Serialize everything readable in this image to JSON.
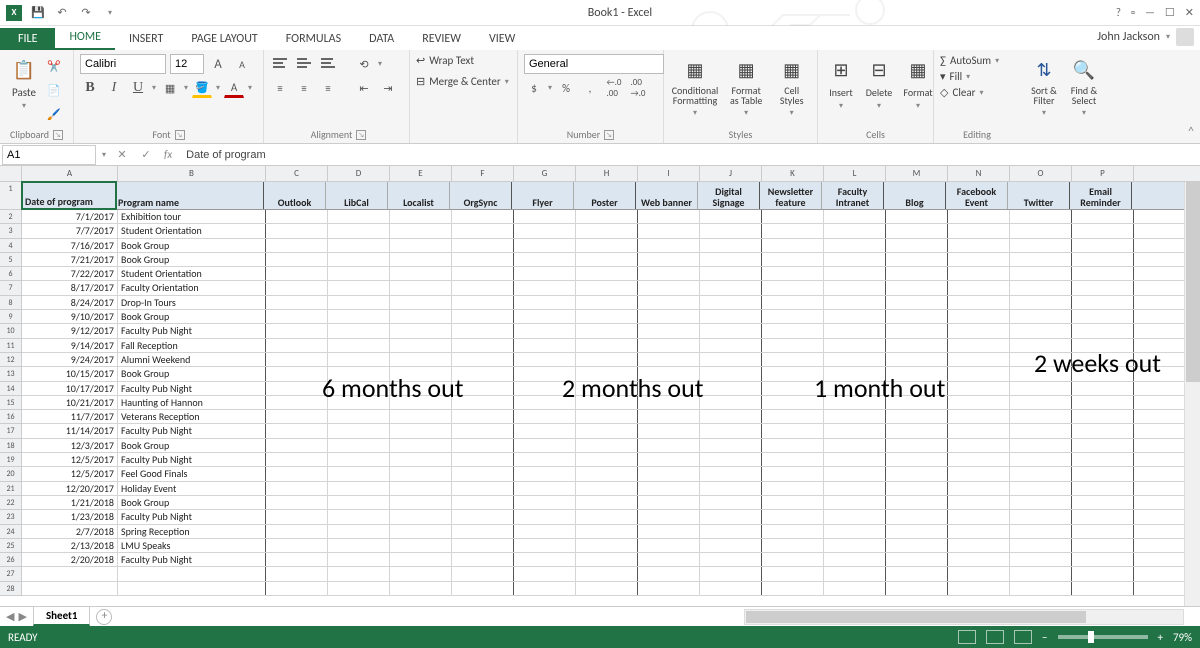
{
  "titlebar": {
    "title": "Book1 - Excel",
    "help": "?"
  },
  "user": {
    "name": "John Jackson"
  },
  "tabs": {
    "file": "FILE",
    "home": "HOME",
    "insert": "INSERT",
    "pageLayout": "PAGE LAYOUT",
    "formulas": "FORMULAS",
    "data": "DATA",
    "review": "REVIEW",
    "view": "VIEW"
  },
  "ribbon": {
    "clipboard": {
      "paste": "Paste",
      "label": "Clipboard"
    },
    "font": {
      "name": "Calibri",
      "size": "12",
      "label": "Font"
    },
    "alignment": {
      "wrap": "Wrap Text",
      "merge": "Merge & Center",
      "label": "Alignment"
    },
    "number": {
      "format": "General",
      "label": "Number"
    },
    "styles": {
      "cond": "Conditional Formatting",
      "fmtTable": "Format as Table",
      "cell": "Cell Styles",
      "label": "Styles"
    },
    "cells": {
      "insert": "Insert",
      "delete": "Delete",
      "format": "Format",
      "label": "Cells"
    },
    "editing": {
      "autosum": "AutoSum",
      "fill": "Fill",
      "clear": "Clear",
      "sort": "Sort & Filter",
      "find": "Find & Select",
      "label": "Editing"
    }
  },
  "formulaBar": {
    "nameBox": "A1",
    "formula": "Date of program"
  },
  "columns": [
    "A",
    "B",
    "C",
    "D",
    "E",
    "F",
    "G",
    "H",
    "I",
    "J",
    "K",
    "L",
    "M",
    "N",
    "O",
    "P"
  ],
  "headerRow": [
    "Date of program",
    "Program name",
    "Outlook",
    "LibCal",
    "Localist",
    "OrgSync",
    "Flyer",
    "Poster",
    "Web banner",
    "Digital Signage",
    "Newsletter feature",
    "Faculty Intranet",
    "Blog",
    "Facebook Event",
    "Twitter",
    "Email Reminder"
  ],
  "rows": [
    {
      "date": "7/1/2017",
      "name": "Exhibition tour"
    },
    {
      "date": "7/7/2017",
      "name": "Student Orientation"
    },
    {
      "date": "7/16/2017",
      "name": "Book Group"
    },
    {
      "date": "7/21/2017",
      "name": "Book Group"
    },
    {
      "date": "7/22/2017",
      "name": "Student Orientation"
    },
    {
      "date": "8/17/2017",
      "name": "Faculty Orientation"
    },
    {
      "date": "8/24/2017",
      "name": "Drop-In Tours"
    },
    {
      "date": "9/10/2017",
      "name": "Book Group"
    },
    {
      "date": "9/12/2017",
      "name": "Faculty Pub Night"
    },
    {
      "date": "9/14/2017",
      "name": "Fall Reception"
    },
    {
      "date": "9/24/2017",
      "name": "Alumni Weekend"
    },
    {
      "date": "10/15/2017",
      "name": "Book Group"
    },
    {
      "date": "10/17/2017",
      "name": "Faculty Pub Night"
    },
    {
      "date": "10/21/2017",
      "name": "Haunting of Hannon"
    },
    {
      "date": "11/7/2017",
      "name": "Veterans Reception"
    },
    {
      "date": "11/14/2017",
      "name": "Faculty Pub Night"
    },
    {
      "date": "12/3/2017",
      "name": "Book Group"
    },
    {
      "date": "12/5/2017",
      "name": "Faculty Pub Night"
    },
    {
      "date": "12/5/2017",
      "name": "Feel Good Finals"
    },
    {
      "date": "12/20/2017",
      "name": "Holiday Event"
    },
    {
      "date": "1/21/2018",
      "name": "Book Group"
    },
    {
      "date": "1/23/2018",
      "name": "Faculty Pub Night"
    },
    {
      "date": "2/7/2018",
      "name": "Spring Reception"
    },
    {
      "date": "2/13/2018",
      "name": "LMU Speaks"
    },
    {
      "date": "2/20/2018",
      "name": "Faculty Pub Night"
    }
  ],
  "overlays": {
    "o1": "6 months out",
    "o2": "2 months out",
    "o3": "1 month out",
    "o4": "2 weeks out"
  },
  "sheets": {
    "sheet1": "Sheet1"
  },
  "status": {
    "ready": "READY",
    "zoom": "79%"
  }
}
